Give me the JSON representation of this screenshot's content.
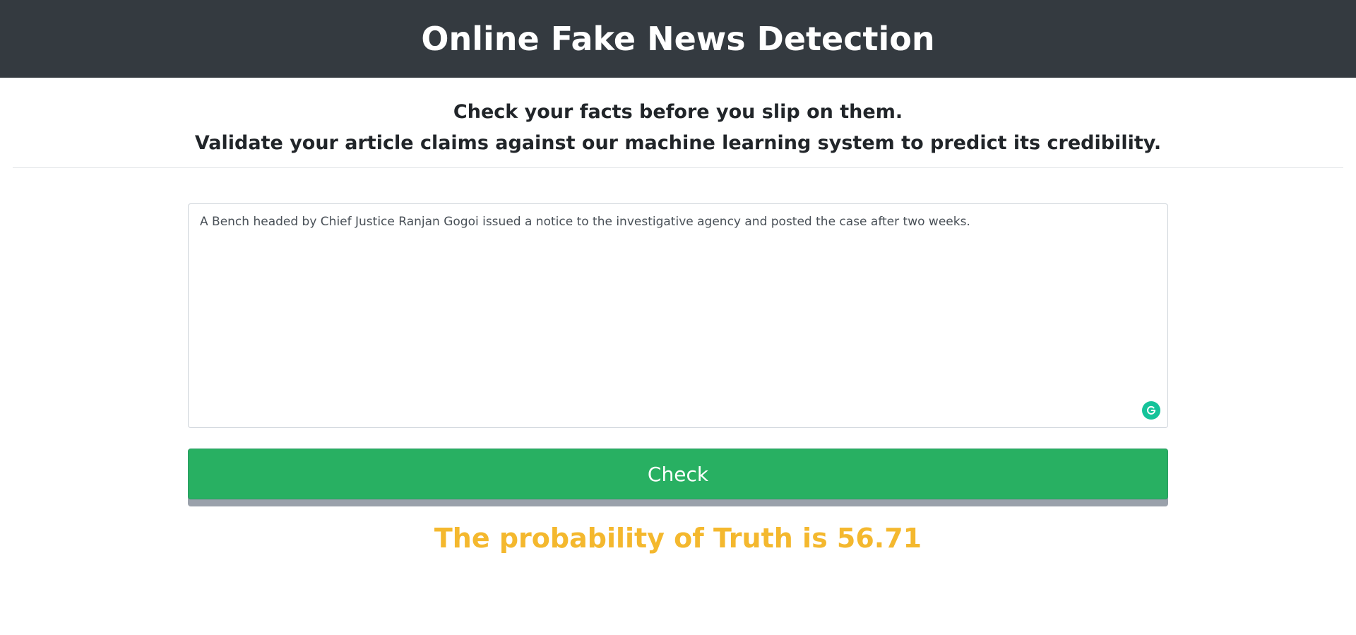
{
  "header": {
    "title": "Online Fake News Detection",
    "background_color": "#343a40"
  },
  "intro": {
    "line1": "Check your facts before you slip on them.",
    "line2": "Validate your article claims against our machine learning system to predict its credibility."
  },
  "form": {
    "claim_text": "A Bench headed by Chief Justice Ranjan Gogoi issued a notice to the investigative agency and posted the case after two weeks.",
    "grammarly_icon": "grammarly-icon",
    "check_label": "Check",
    "check_color": "#28b062"
  },
  "result": {
    "text": "The probability of Truth is 56.71",
    "probability": 56.71,
    "color": "#f4b82e"
  }
}
